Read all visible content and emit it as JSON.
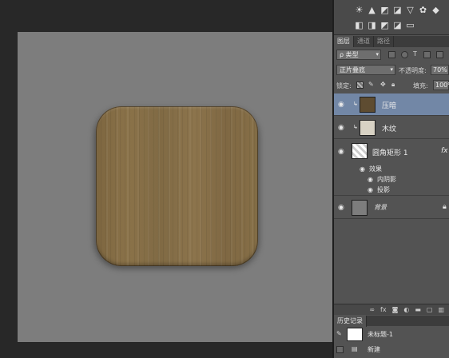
{
  "layers_panel": {
    "tabs": [
      "图层",
      "通道",
      "路径"
    ],
    "filter_kind": "ρ 类型",
    "blend_mode": "正片叠底",
    "opacity_label": "不透明度:",
    "opacity_value": "70%",
    "lock_label": "锁定:",
    "fill_label": "填充:",
    "fill_value": "100%",
    "layers": [
      {
        "name": "压暗",
        "selected": true,
        "clipped": true
      },
      {
        "name": "木纹",
        "selected": false,
        "clipped": true
      },
      {
        "name": "圆角矩形 1",
        "fx": "fx"
      },
      {
        "name": "效果"
      },
      {
        "name": "内阴影"
      },
      {
        "name": "投影"
      },
      {
        "name": "背景",
        "italic": true
      }
    ]
  },
  "history_panel": {
    "tab": "历史记录",
    "snapshot": "未标题-1",
    "states": [
      "新建"
    ]
  },
  "colors": {
    "panel_bg": "#535353",
    "selected_layer": "#7287a6",
    "canvas_gray": "#7d7d7d",
    "wood": "#856e47"
  }
}
